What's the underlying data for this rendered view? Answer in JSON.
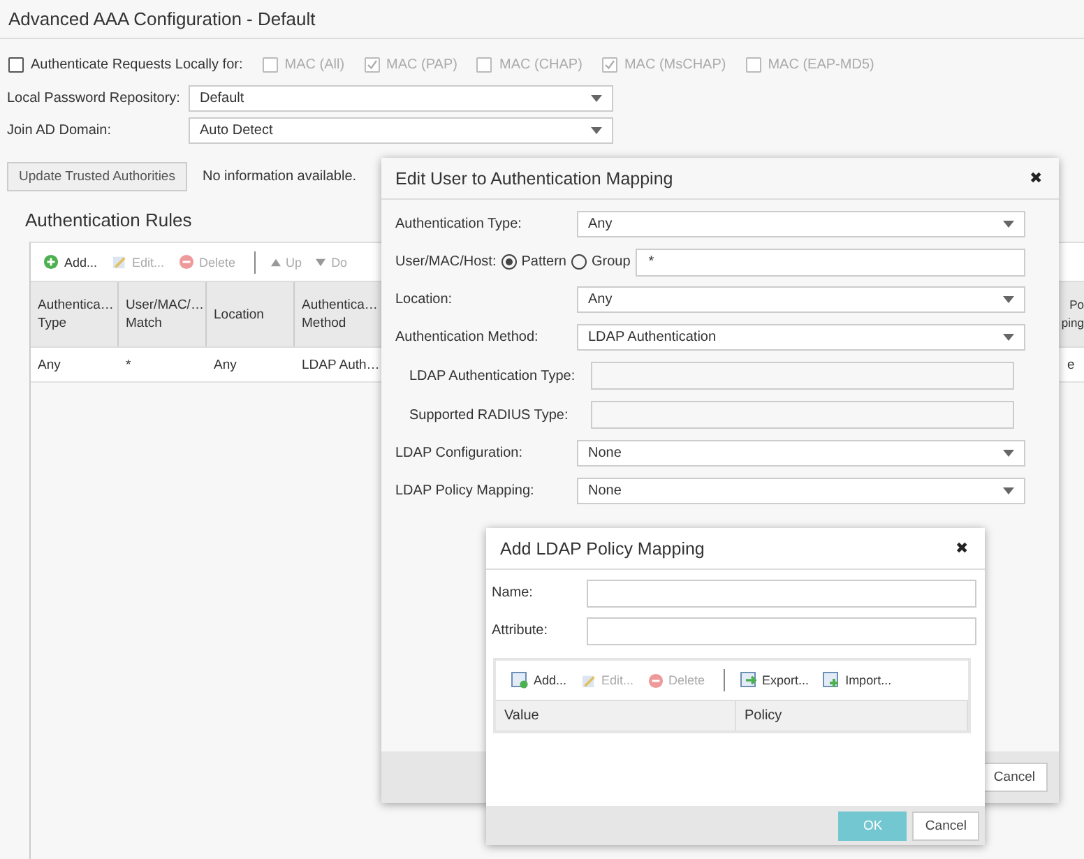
{
  "page": {
    "title": "Advanced AAA Configuration - Default"
  },
  "local_auth": {
    "label": "Authenticate Requests Locally for:",
    "checked": false,
    "options": [
      {
        "label": "MAC (All)",
        "checked": false,
        "disabled": true
      },
      {
        "label": "MAC (PAP)",
        "checked": true,
        "disabled": true
      },
      {
        "label": "MAC (CHAP)",
        "checked": false,
        "disabled": true
      },
      {
        "label": "MAC (MsCHAP)",
        "checked": true,
        "disabled": true
      },
      {
        "label": "MAC (EAP-MD5)",
        "checked": false,
        "disabled": true
      }
    ]
  },
  "fields": [
    {
      "label": "Local Password Repository:",
      "value": "Default"
    },
    {
      "label": "Join AD Domain:",
      "value": "Auto Detect"
    }
  ],
  "trusted": {
    "button": "Update Trusted Authorities",
    "status": "No information available."
  },
  "rules": {
    "title": "Authentication Rules",
    "toolbar": [
      {
        "kind": "add",
        "label": "Add...",
        "disabled": false
      },
      {
        "kind": "edit",
        "label": "Edit...",
        "disabled": true
      },
      {
        "kind": "delete",
        "label": "Delete",
        "disabled": true
      },
      {
        "kind": "separator"
      },
      {
        "kind": "up",
        "label": "Up",
        "disabled": true
      },
      {
        "kind": "down",
        "label": "Do",
        "disabled": true
      }
    ],
    "columns": [
      {
        "lines": [
          "Authentica…",
          "Type"
        ]
      },
      {
        "lines": [
          "User/MAC/…",
          "Match"
        ]
      },
      {
        "lines": [
          "Location"
        ]
      },
      {
        "lines": [
          "Authentica…",
          "Method"
        ]
      }
    ],
    "rows": [
      [
        "Any",
        "*",
        "Any",
        "LDAP Auth…"
      ]
    ],
    "column_edge": {
      "lines": [
        "Po",
        "ping"
      ],
      "cell": "e"
    }
  },
  "edit_dialog": {
    "title": "Edit User to Authentication Mapping",
    "close": "✖",
    "rows": [
      {
        "kind": "select",
        "label": "Authentication Type:",
        "value": "Any"
      },
      {
        "kind": "pattern",
        "label": "User/MAC/Host:",
        "options": [
          {
            "label": "Pattern",
            "selected": true
          },
          {
            "label": "Group",
            "selected": false
          }
        ],
        "value": "*"
      },
      {
        "kind": "select",
        "label": "Location:",
        "value": "Any"
      },
      {
        "kind": "select",
        "label": "Authentication Method:",
        "value": "LDAP Authentication",
        "children": [
          {
            "label": "LDAP Authentication Type:"
          },
          {
            "label": "Supported RADIUS Type:"
          }
        ]
      },
      {
        "kind": "select",
        "label": "LDAP Configuration:",
        "value": "None"
      },
      {
        "kind": "select",
        "label": "LDAP Policy Mapping:",
        "value": "None"
      }
    ],
    "buttons": [
      {
        "label": "Cancel",
        "kind": "default"
      }
    ]
  },
  "policy_dialog": {
    "title": "Add LDAP Policy Mapping",
    "close": "✖",
    "fields": [
      {
        "label": "Name:"
      },
      {
        "label": "Attribute:"
      }
    ],
    "toolbar": [
      {
        "kind": "add",
        "label": "Add...",
        "disabled": false
      },
      {
        "kind": "edit",
        "label": "Edit...",
        "disabled": true
      },
      {
        "kind": "delete",
        "label": "Delete",
        "disabled": true
      },
      {
        "kind": "separator"
      },
      {
        "kind": "export",
        "label": "Export...",
        "disabled": false
      },
      {
        "kind": "import",
        "label": "Import...",
        "disabled": false
      }
    ],
    "columns": [
      "Value",
      "Policy"
    ],
    "buttons": [
      {
        "label": "OK",
        "kind": "primary"
      },
      {
        "label": "Cancel",
        "kind": "default"
      }
    ]
  }
}
